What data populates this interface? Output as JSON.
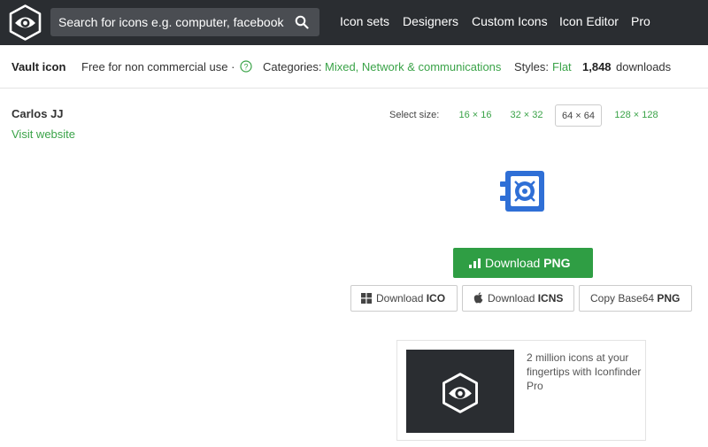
{
  "header": {
    "search_placeholder": "Search for icons e.g. computer, facebook",
    "nav": [
      "Icon sets",
      "Designers",
      "Custom Icons",
      "Icon Editor",
      "Pro"
    ]
  },
  "info": {
    "icon_name": "Vault icon",
    "license": "Free for non commercial use ·",
    "categories_label": "Categories:",
    "categories_value": "Mixed, Network & communications",
    "styles_label": "Styles:",
    "styles_value": "Flat",
    "downloads_count": "1,848",
    "downloads_label": "downloads"
  },
  "author": {
    "name": "Carlos JJ",
    "link": "Visit website"
  },
  "sizes": {
    "label": "Select size:",
    "options": [
      "16 × 16",
      "32 × 32",
      "64 × 64",
      "128 × 128"
    ],
    "selected": "64 × 64"
  },
  "downloads": {
    "png_prefix": "Download",
    "png_format": "PNG",
    "ico_prefix": "Download",
    "ico_format": "ICO",
    "icns_prefix": "Download",
    "icns_format": "ICNS",
    "base64_prefix": "Copy Base64",
    "base64_format": "PNG"
  },
  "promo": {
    "text": "2 million icons at your fingertips with Iconfinder Pro"
  },
  "colors": {
    "topbar": "#2a2d31",
    "accent_green": "#3aa348",
    "button_green": "#2f9e44",
    "vault_blue": "#2f6fd6"
  }
}
